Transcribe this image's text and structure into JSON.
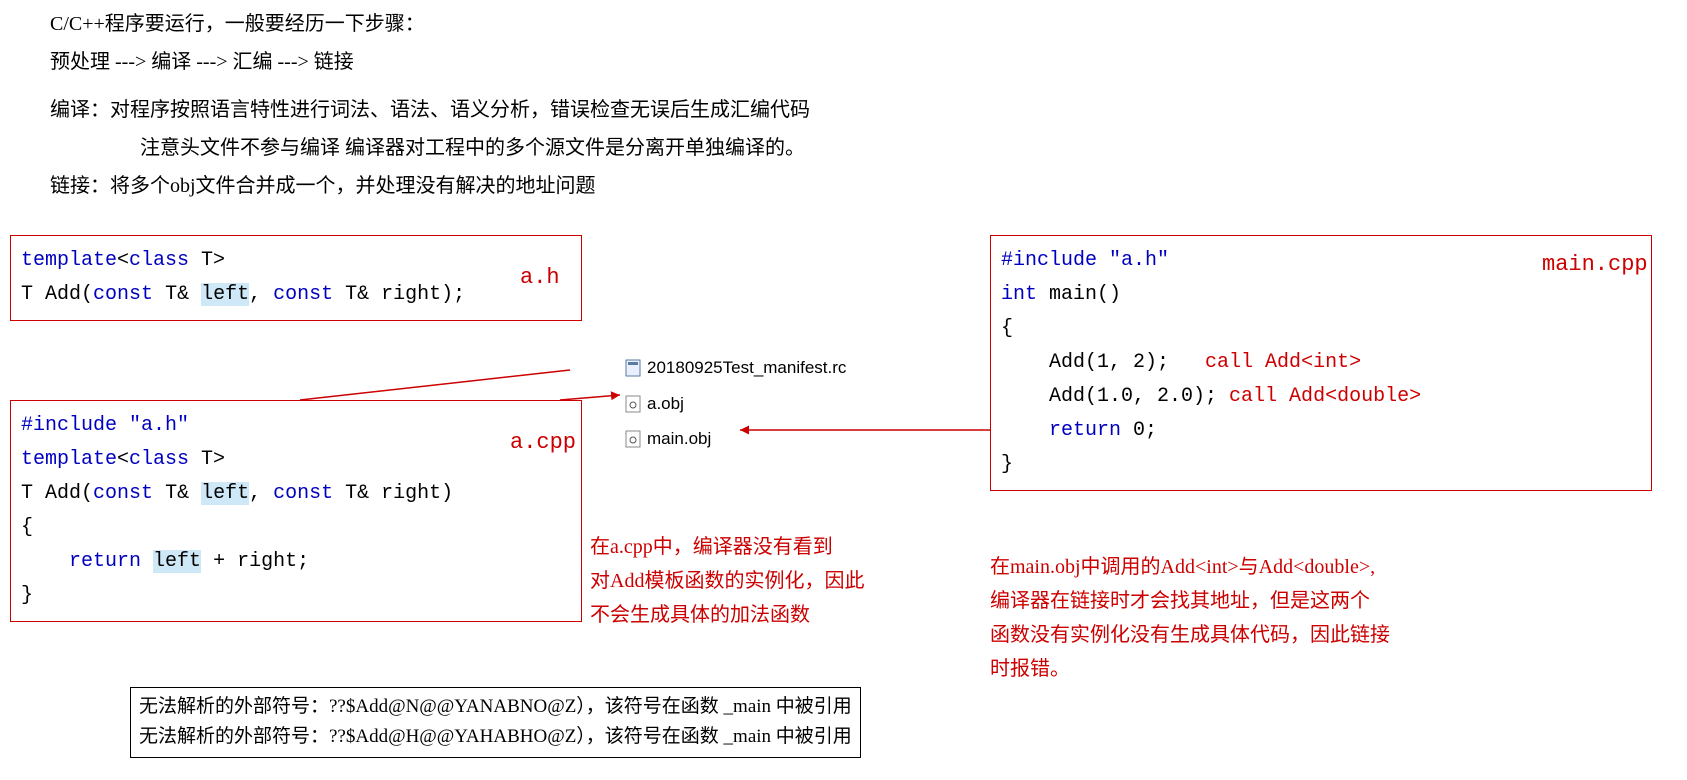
{
  "intro": {
    "l1": "C/C++程序要运行，一般要经历一下步骤：",
    "l2": "预处理 ---> 编译 ---> 汇编 ---> 链接",
    "l3": "编译：对程序按照语言特性进行词法、语法、语义分析，错误检查无误后生成汇编代码",
    "l4": "注意头文件不参与编译  编译器对工程中的多个源文件是分离开单独编译的。",
    "l5": "链接：将多个obj文件合并成一个，并处理没有解决的地址问题"
  },
  "labels": {
    "ah": "a.h",
    "acpp": "a.cpp",
    "maincpp": "main.cpp"
  },
  "ah": {
    "l1_a": "template",
    "l1_b": "<",
    "l1_c": "class",
    "l1_d": " T>",
    "l2_a": "T ",
    "l2_b": "Add",
    "l2_c": "(",
    "l2_d": "const",
    "l2_e": " T& ",
    "l2_f": "left",
    "l2_g": ", ",
    "l2_h": "const",
    "l2_i": " T& right);"
  },
  "acpp": {
    "l1_a": "#include ",
    "l1_b": "\"a.h\"",
    "l2_a": "template",
    "l2_b": "<",
    "l2_c": "class",
    "l2_d": " T>",
    "l3_a": "T ",
    "l3_b": "Add",
    "l3_c": "(",
    "l3_d": "const",
    "l3_e": " T& ",
    "l3_f": "left",
    "l3_g": ", ",
    "l3_h": "const",
    "l3_i": " T& right)",
    "l4": "{",
    "l5_a": "    ",
    "l5_b": "return",
    "l5_c": " ",
    "l5_d": "left",
    "l5_e": " + right;",
    "l6": "}"
  },
  "maincpp": {
    "l1_a": "#include ",
    "l1_b": "\"a.h\"",
    "l2_a": "int",
    "l2_b": " main()",
    "l3": "{",
    "l4_a": "    Add(1, 2);   ",
    "l4_ann": "call Add<int>",
    "l5_a": "    Add(1.0, 2.0);",
    "l5_ann": " call Add<double>",
    "l6_a": "    ",
    "l6_b": "return",
    "l6_c": " 0;",
    "l7": "}"
  },
  "files": {
    "f1": "20180925Test_manifest.rc",
    "f2": "a.obj",
    "f3": "main.obj"
  },
  "note_acpp": {
    "l1": "在a.cpp中，编译器没有看到",
    "l2": "对Add模板函数的实例化，因此",
    "l3": "不会生成具体的加法函数"
  },
  "note_main": {
    "l1": "在main.obj中调用的Add<int>与Add<double>,",
    "l2": "编译器在链接时才会找其地址，但是这两个",
    "l3": "函数没有实例化没有生成具体代码，因此链接",
    "l4": "时报错。"
  },
  "err": {
    "l1": "无法解析的外部符号：??$Add@N@@YANABNO@Z），该符号在函数 _main 中被引用",
    "l2": "无法解析的外部符号：??$Add@H@@YAHABHO@Z），该符号在函数 _main 中被引用"
  }
}
